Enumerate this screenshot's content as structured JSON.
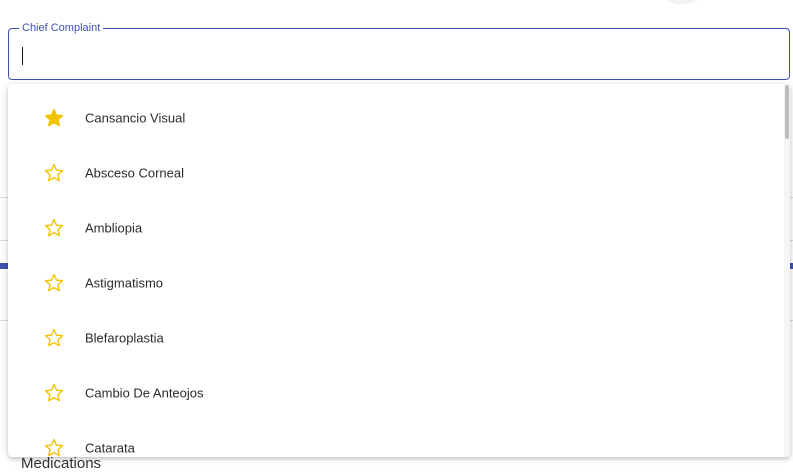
{
  "chief_complaint": {
    "label": "Chief Complaint",
    "value": "",
    "placeholder": ""
  },
  "background": {
    "medications_heading": "Medications"
  },
  "accent_color": "#3f51b5",
  "star_color": "#f2c400",
  "dropdown": {
    "options": [
      {
        "label": "Cansancio Visual",
        "favorite": true,
        "icon": "star-filled-icon"
      },
      {
        "label": "Absceso Corneal",
        "favorite": false,
        "icon": "star-outline-icon"
      },
      {
        "label": "Ambliopia",
        "favorite": false,
        "icon": "star-outline-icon"
      },
      {
        "label": "Astigmatismo",
        "favorite": false,
        "icon": "star-outline-icon"
      },
      {
        "label": "Blefaroplastia",
        "favorite": false,
        "icon": "star-outline-icon"
      },
      {
        "label": "Cambio De Anteojos",
        "favorite": false,
        "icon": "star-outline-icon"
      },
      {
        "label": "Catarata",
        "favorite": false,
        "icon": "star-outline-icon"
      }
    ]
  }
}
